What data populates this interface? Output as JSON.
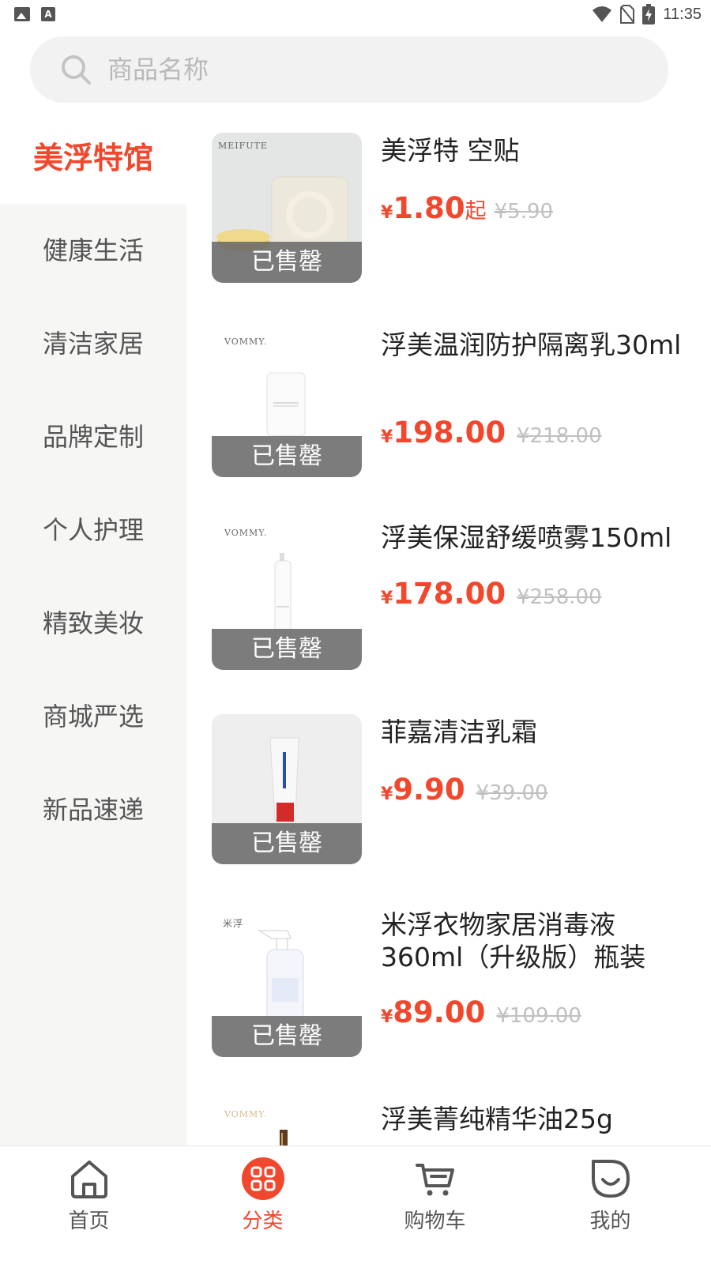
{
  "status_bar": {
    "time": "11:35"
  },
  "search": {
    "placeholder": "商品名称"
  },
  "sidebar": {
    "active": "美浮特馆",
    "items": [
      "健康生活",
      "清洁家居",
      "品牌定制",
      "个人护理",
      "精致美妆",
      "商城严选",
      "新品速递"
    ]
  },
  "products": [
    {
      "name": "美浮特 空贴",
      "currency": "¥",
      "price": "1.80",
      "suffix": "起",
      "original": "¥5.90",
      "badge": "已售罄",
      "image_brand": "MEIFUTE"
    },
    {
      "name": "浮美温润防护隔离乳30ml",
      "currency": "¥",
      "price": "198.00",
      "original": "¥218.00",
      "badge": "已售罄",
      "image_brand": "VOMMY."
    },
    {
      "name": "浮美保湿舒缓喷雾150ml",
      "currency": "¥",
      "price": "178.00",
      "original": "¥258.00",
      "badge": "已售罄",
      "image_brand": "VOMMY."
    },
    {
      "name": "菲嘉清洁乳霜",
      "currency": "¥",
      "price": "9.90",
      "original": "¥39.00",
      "badge": "已售罄"
    },
    {
      "name": "米浮衣物家居消毒液360ml（升级版）瓶装",
      "currency": "¥",
      "price": "89.00",
      "original": "¥109.00",
      "badge": "已售罄",
      "image_brand": "米浮"
    },
    {
      "name": "浮美菁纯精华油25g",
      "image_brand": "VOMMY."
    }
  ],
  "tabbar": {
    "items": [
      {
        "label": "首页",
        "icon": "home-icon"
      },
      {
        "label": "分类",
        "icon": "category-icon",
        "active": true
      },
      {
        "label": "购物车",
        "icon": "cart-icon"
      },
      {
        "label": "我的",
        "icon": "profile-icon"
      }
    ]
  },
  "colors": {
    "accent": "#f1482d",
    "sidebar_bg": "#f6f6f5",
    "search_bg": "#f2f2f2"
  }
}
